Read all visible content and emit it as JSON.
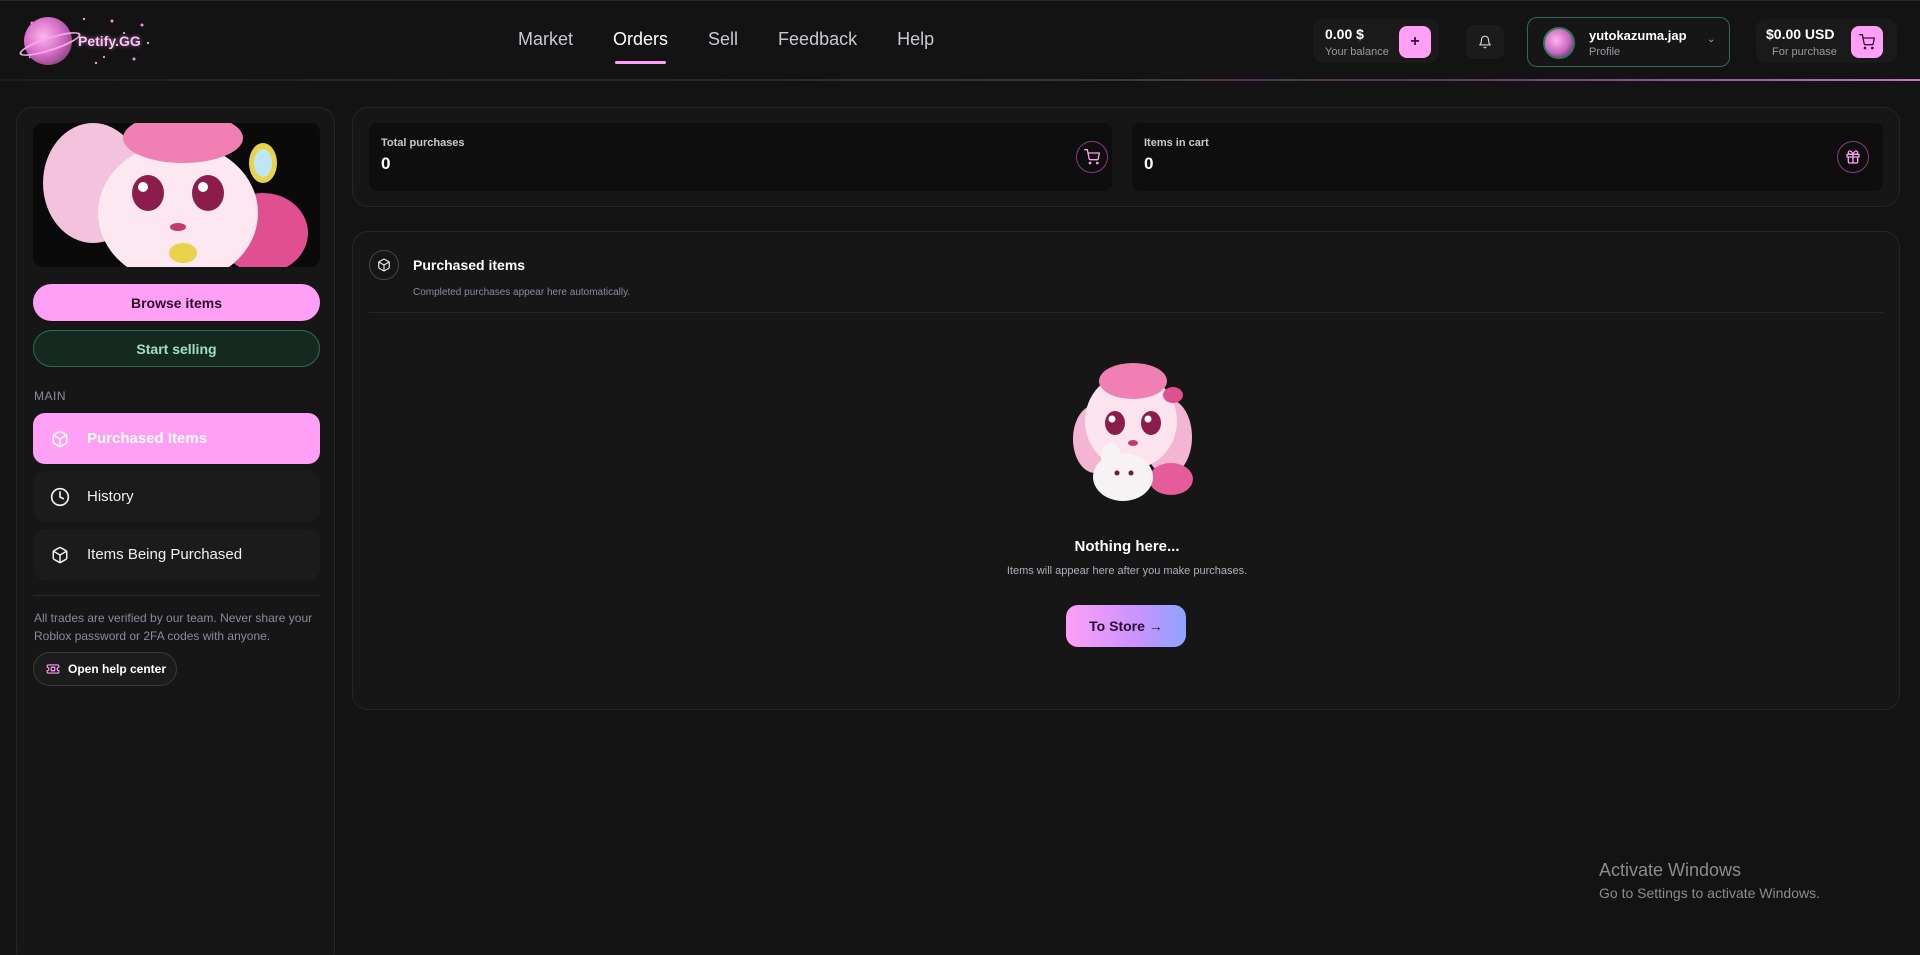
{
  "brand": {
    "name": "Petify.GG"
  },
  "nav": {
    "items": [
      {
        "label": "Market"
      },
      {
        "label": "Orders",
        "active": true
      },
      {
        "label": "Sell"
      },
      {
        "label": "Feedback"
      },
      {
        "label": "Help"
      }
    ]
  },
  "balance": {
    "amount": "0.00 $",
    "label": "Your balance",
    "add_label": "+"
  },
  "profile": {
    "name": "yutokazuma.jap",
    "label": "Profile"
  },
  "cart": {
    "amount": "$0.00 USD",
    "label": "For purchase"
  },
  "sidebar": {
    "browse_label": "Browse items",
    "sell_label": "Start selling",
    "section_label": "MAIN",
    "items": [
      {
        "label": "Purchased Items",
        "icon": "box-icon",
        "active": true
      },
      {
        "label": "History",
        "icon": "clock-icon"
      },
      {
        "label": "Items Being Purchased",
        "icon": "box-icon"
      }
    ],
    "note": "All trades are verified by our team. Never share your Roblox password or 2FA codes with anyone.",
    "help_label": "Open help center"
  },
  "stats": [
    {
      "label": "Total purchases",
      "value": "0",
      "icon": "cart-icon"
    },
    {
      "label": "Items in cart",
      "value": "0",
      "icon": "gift-icon"
    }
  ],
  "purchased": {
    "title": "Purchased items",
    "subtitle": "Completed purchases appear here automatically.",
    "empty_title": "Nothing here...",
    "empty_subtitle": "Items will appear here after you make purchases.",
    "store_label": "To Store →"
  },
  "watermark": {
    "title": "Activate Windows",
    "subtitle": "Go to Settings to activate Windows."
  },
  "colors": {
    "accent": "#ff9ff5",
    "background": "#131313",
    "sell_green": "#2f6b54"
  }
}
